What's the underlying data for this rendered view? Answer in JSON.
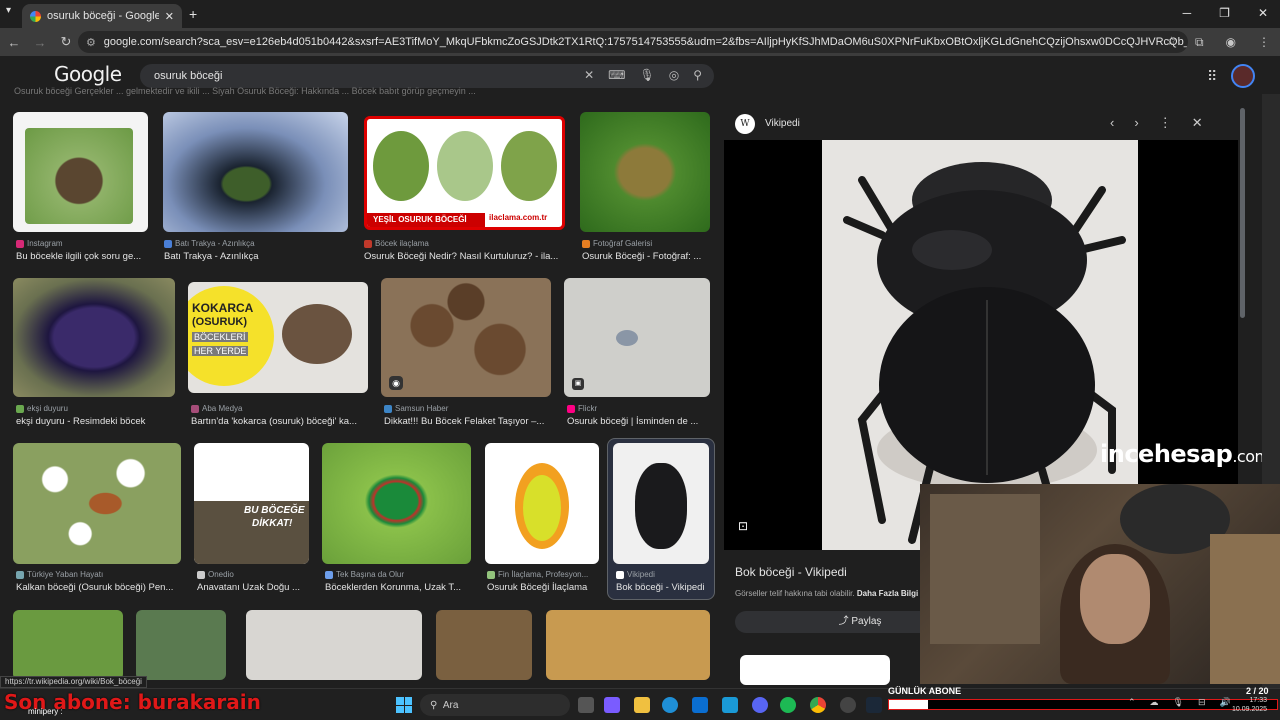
{
  "browser": {
    "tab_title": "osuruk böceği - Google'da Ara",
    "new_tab": "+",
    "url": "google.com/search?sca_esv=e126eb4d051b0442&sxsrf=AE3TifMoY_MkqUFbkmcZoGSJDtk2TX1RtQ:1757514753555&udm=2&fbs=AIljpHyKfSJhMDaOM6uS0XPNrFuKbxOBtOxljKGLdGnehCQzijOhsxw0DCcQJHVRcQb_LQVNkX9hAj60JyrbPXhSkhDM5krP9O..."
  },
  "google": {
    "logo": "Google",
    "query": "osuruk böceği",
    "top_strip": "Osuruk böceği  Gerçekler ... gelmektedir ve ikili ...     Siyah Osuruk Böceği: Hakkında ...                                                          Böcek babıt görüp geçmeyin ..."
  },
  "results": [
    {
      "source": "Instagram",
      "caption": "Bu böcekle ilgili çok soru ge...",
      "color": "#d62976"
    },
    {
      "source": "Batı Trakya - Azınlıkça",
      "caption": "Batı Trakya - Azınlıkça",
      "color": "#4a7fd6"
    },
    {
      "source": "Böcek ilaçlama",
      "caption": "Osuruk Böceği Nedir? Nasıl Kurtuluruz? - ila...",
      "color": "#c0392b"
    },
    {
      "source": "Fotoğraf Galerisi",
      "caption": "Osuruk Böceği - Fotoğraf: ...",
      "color": "#e67e22"
    },
    {
      "source": "ekşi duyuru",
      "caption": "ekşi duyuru - Resimdeki böcek",
      "color": "#6aa84f"
    },
    {
      "source": "Aba Medya",
      "caption": "Bartın'da 'kokarca (osuruk) böceği' ka...",
      "color": "#a64d79"
    },
    {
      "source": "Samsun Haber",
      "caption": "Dikkat!!! Bu Böcek Felaket Taşıyor –...",
      "color": "#3d85c6"
    },
    {
      "source": "Flickr",
      "caption": "Osuruk böceği | İsminden de ...",
      "color": "#ff0084"
    },
    {
      "source": "Türkiye Yaban Hayatı",
      "caption": "Kalkan böceği (Osuruk böceği) Pen...",
      "color": "#76a5af"
    },
    {
      "source": "Onedio",
      "caption": "Anavatanı Uzak Doğu ...",
      "color": "#cccccc"
    },
    {
      "source": "Tek Başına da Olur",
      "caption": "Böceklerden Korunma, Uzak T...",
      "color": "#6d9eeb"
    },
    {
      "source": "Fin İlaçlama, Profesyon...",
      "caption": "Osuruk Böceği İlaçlama",
      "color": "#93c47d"
    },
    {
      "source": "Vikipedi",
      "caption": "Bok böceği - Vikipedi",
      "color": "#ffffff"
    }
  ],
  "thumb_text": {
    "yesil": "YEŞİL OSURUK BÖCEĞİ",
    "ilaclama": "ilaclama.com.tr",
    "kokarca_1": "KOKARCA",
    "kokarca_2": "(OSURUK)",
    "kokarca_3": "BÖCEKLERİ",
    "kokarca_4": "HER YERDE",
    "dikkat_1": "BU BÖCEĞE",
    "dikkat_2": "DİKKAT!"
  },
  "preview": {
    "source": "Vikipedi",
    "wiki_glyph": "W",
    "title": "Bok böceği - Vikipedi",
    "copyright": "Görseller telif hakkına tabi olabilir.",
    "more_info": "Daha Fazla Bilgi",
    "share": "Paylaş",
    "watermark_main": "incehesap",
    "watermark_tld": ".com"
  },
  "status_url": "https://tr.wikipedia.org/wiki/Bok_böceği",
  "taskbar": {
    "search": "Ara",
    "date": "10.09.2025",
    "time": "17:33"
  },
  "overlay": {
    "last_sub": "Son abone: burakarain",
    "small": "minipery :",
    "sub_label": "GÜNLÜK ABONE",
    "sub_count": "2 / 20",
    "sub_progress": 0.1
  },
  "icons": [
    "back-icon",
    "forward-icon",
    "reload-icon",
    "site-info-icon",
    "star-icon",
    "extensions-icon",
    "profile-icon",
    "menu-icon",
    "clear-icon",
    "keyboard-icon",
    "mic-icon",
    "lens-icon",
    "search-icon",
    "apps-icon",
    "prev-icon",
    "next-icon",
    "more-icon",
    "close-icon",
    "share-icon"
  ]
}
